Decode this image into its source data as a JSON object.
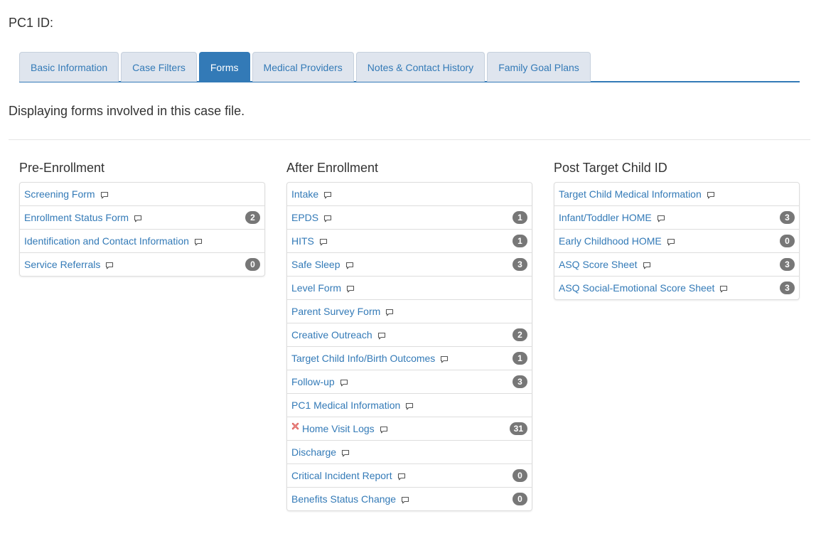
{
  "header": {
    "pc1_label": "PC1 ID:"
  },
  "tabs": [
    {
      "label": "Basic Information",
      "active": false
    },
    {
      "label": "Case Filters",
      "active": false
    },
    {
      "label": "Forms",
      "active": true
    },
    {
      "label": "Medical Providers",
      "active": false
    },
    {
      "label": "Notes & Contact History",
      "active": false
    },
    {
      "label": "Family Goal Plans",
      "active": false
    }
  ],
  "intro_text": "Displaying forms involved in this case file.",
  "columns": [
    {
      "title": "Pre-Enrollment",
      "items": [
        {
          "label": "Screening Form",
          "badge": ""
        },
        {
          "label": "Enrollment Status Form",
          "badge": "2"
        },
        {
          "label": "Identification and Contact Information",
          "badge": ""
        },
        {
          "label": "Service Referrals",
          "badge": "0"
        }
      ]
    },
    {
      "title": "After Enrollment",
      "items": [
        {
          "label": "Intake",
          "badge": ""
        },
        {
          "label": "EPDS",
          "badge": "1"
        },
        {
          "label": "HITS",
          "badge": "1"
        },
        {
          "label": "Safe Sleep",
          "badge": "3"
        },
        {
          "label": "Level Form",
          "badge": ""
        },
        {
          "label": "Parent Survey Form",
          "badge": ""
        },
        {
          "label": "Creative Outreach",
          "badge": "2"
        },
        {
          "label": "Target Child Info/Birth Outcomes",
          "badge": "1"
        },
        {
          "label": "Follow-up",
          "badge": "3"
        },
        {
          "label": "PC1 Medical Information",
          "badge": ""
        },
        {
          "label": "Home Visit Logs",
          "badge": "31",
          "flagged": true
        },
        {
          "label": "Discharge",
          "badge": ""
        },
        {
          "label": "Critical Incident Report",
          "badge": "0"
        },
        {
          "label": "Benefits Status Change",
          "badge": "0"
        }
      ]
    },
    {
      "title": "Post Target Child ID",
      "items": [
        {
          "label": "Target Child Medical Information",
          "badge": ""
        },
        {
          "label": "Infant/Toddler HOME",
          "badge": "3"
        },
        {
          "label": "Early Childhood HOME",
          "badge": "0"
        },
        {
          "label": "ASQ Score Sheet",
          "badge": "3"
        },
        {
          "label": "ASQ Social-Emotional Score Sheet",
          "badge": "3"
        }
      ]
    }
  ],
  "icons": {
    "comment": "comment-icon",
    "flag": "red-x-icon"
  },
  "colors": {
    "link": "#337ab7",
    "badge": "#777777",
    "active_tab": "#337ab7",
    "tab_bg": "#dfe5ee"
  }
}
